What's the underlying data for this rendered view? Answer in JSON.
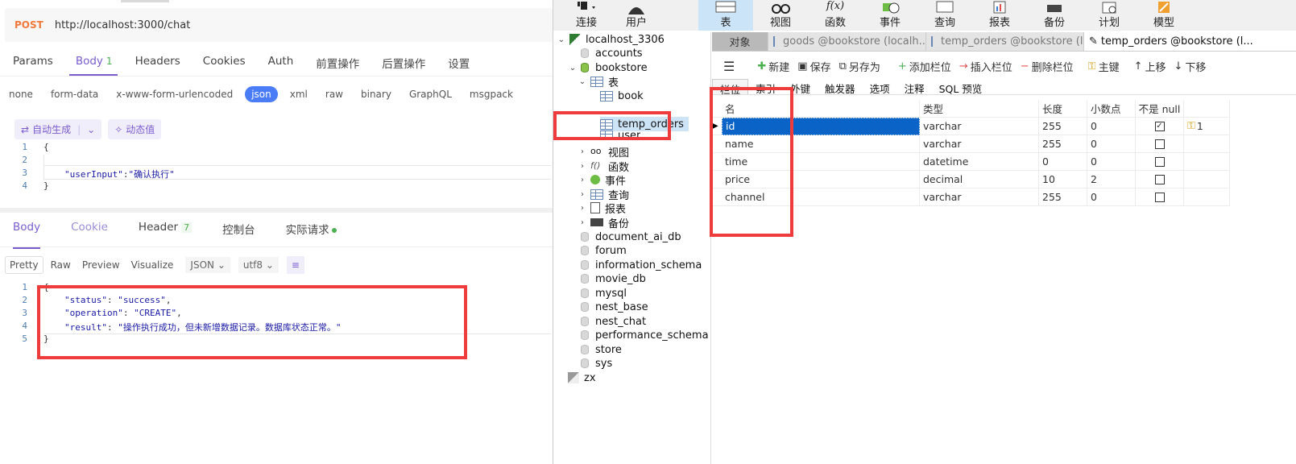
{
  "api": {
    "method": "POST",
    "url": "http://localhost:3000/chat",
    "request_tabs": [
      {
        "label": "Params"
      },
      {
        "label": "Body",
        "count": "1"
      },
      {
        "label": "Headers"
      },
      {
        "label": "Cookies"
      },
      {
        "label": "Auth"
      },
      {
        "label": "前置操作"
      },
      {
        "label": "后置操作"
      },
      {
        "label": "设置"
      }
    ],
    "body_types": [
      "none",
      "form-data",
      "x-www-form-urlencoded",
      "json",
      "xml",
      "raw",
      "binary",
      "GraphQL",
      "msgpack"
    ],
    "active_body_type": "json",
    "auto_generate": "自动生成",
    "dynamic_value": "动态值",
    "request_lines": [
      "1",
      "2",
      "3",
      "4"
    ],
    "request_body": {
      "open": "{",
      "key": "\"userInput\"",
      "colon": ":",
      "value": "\"确认执行\"",
      "close": "}"
    },
    "response_tabs": [
      {
        "label": "Body"
      },
      {
        "label": "Cookie"
      },
      {
        "label": "Header",
        "count": "7"
      },
      {
        "label": "控制台"
      },
      {
        "label": "实际请求"
      }
    ],
    "format_options": [
      "Pretty",
      "Raw",
      "Preview",
      "Visualize"
    ],
    "format_select": "JSON",
    "encoding_select": "utf8",
    "response_lines": [
      "1",
      "2",
      "3",
      "4",
      "5"
    ],
    "response_body": {
      "open": "{",
      "status_key": "\"status\"",
      "status_val": "\"success\"",
      "operation_key": "\"operation\"",
      "operation_val": "\"CREATE\"",
      "result_key": "\"result\"",
      "result_val": "\"操作执行成功，但未新增数据记录。数据库状态正常。\"",
      "close": "}"
    }
  },
  "navicat": {
    "toolbar": [
      "连接",
      "用户",
      "表",
      "视图",
      "函数",
      "事件",
      "查询",
      "报表",
      "备份",
      "计划",
      "模型"
    ],
    "connection": "localhost_3306",
    "tree": {
      "accounts": "accounts",
      "bookstore": "bookstore",
      "tables_group": "表",
      "tables": [
        "book",
        "temp_orders",
        "user"
      ],
      "groups": [
        "视图",
        "函数",
        "事件",
        "查询",
        "报表",
        "备份"
      ],
      "databases": [
        "document_ai_db",
        "forum",
        "information_schema",
        "movie_db",
        "mysql",
        "nest_base",
        "nest_chat",
        "performance_schema",
        "store",
        "sys"
      ],
      "other_connection": "zx"
    },
    "tabs": [
      "对象",
      "goods @bookstore (localh...",
      "temp_orders @bookstore (l...",
      "temp_orders @bookstore (l..."
    ],
    "actions": [
      "新建",
      "保存",
      "另存为",
      "添加栏位",
      "插入栏位",
      "删除栏位",
      "主键",
      "上移",
      "下移"
    ],
    "sub_tabs": [
      "栏位",
      "索引",
      "外键",
      "触发器",
      "选项",
      "注释",
      "SQL 预览"
    ],
    "columns": [
      "名",
      "类型",
      "长度",
      "小数点",
      "不是 null"
    ],
    "rows": [
      {
        "name": "id",
        "type": "varchar",
        "length": "255",
        "decimal": "0",
        "not_null": true,
        "key": "1"
      },
      {
        "name": "name",
        "type": "varchar",
        "length": "255",
        "decimal": "0",
        "not_null": false,
        "key": ""
      },
      {
        "name": "time",
        "type": "datetime",
        "length": "0",
        "decimal": "0",
        "not_null": false,
        "key": ""
      },
      {
        "name": "price",
        "type": "decimal",
        "length": "10",
        "decimal": "2",
        "not_null": false,
        "key": ""
      },
      {
        "name": "channel",
        "type": "varchar",
        "length": "255",
        "decimal": "0",
        "not_null": false,
        "key": ""
      }
    ]
  },
  "colors": {
    "accent": "#7a5ccf",
    "method": "#f2783b",
    "json_pill": "#4a7cf7",
    "annotation_red": "#ee3b3b",
    "row_selected": "#0a64c8"
  }
}
